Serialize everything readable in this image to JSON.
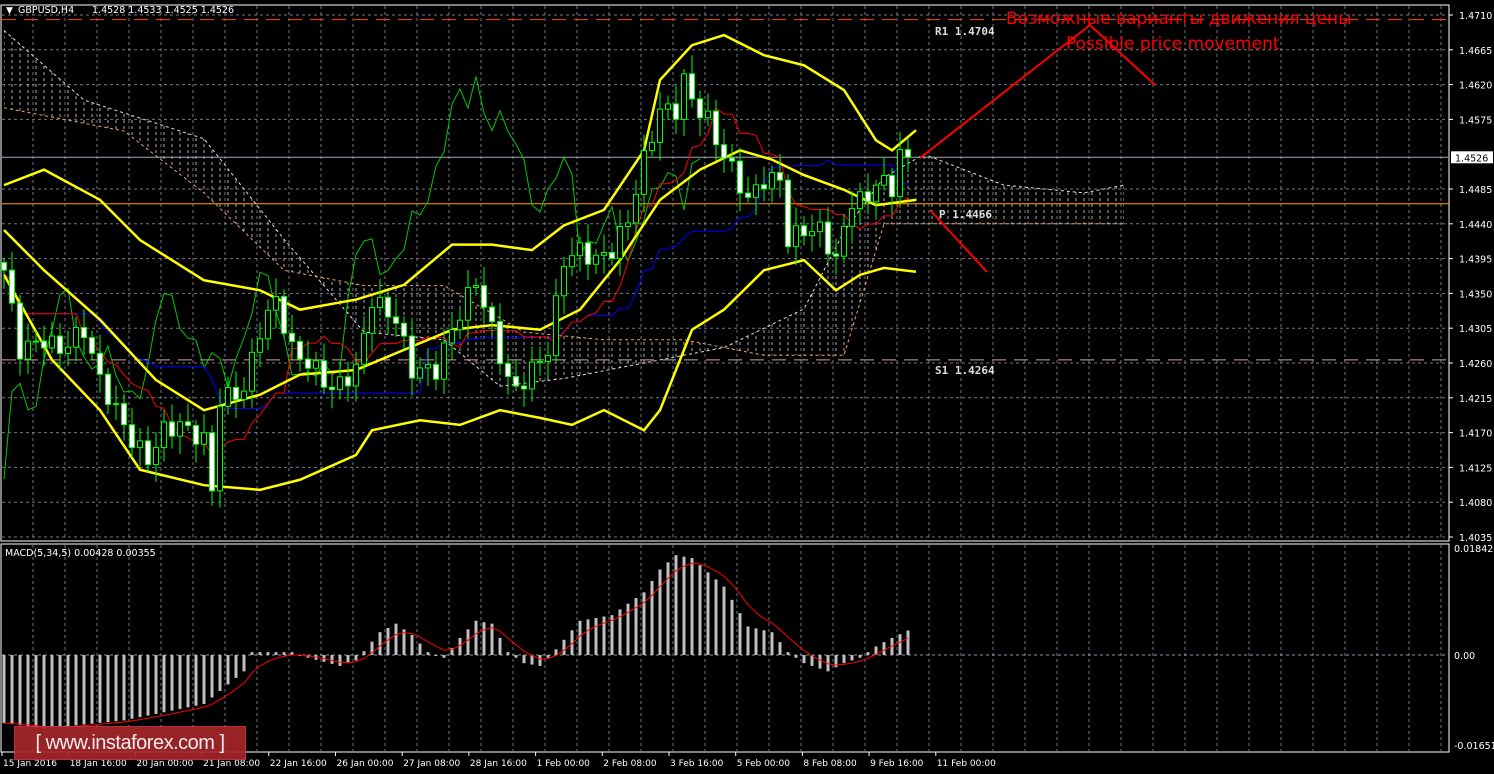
{
  "header": {
    "symbol": "GBPUSD,H4",
    "ohlc": "1.4528 1.4533 1.4525 1.4526"
  },
  "macd_header": {
    "label": "MACD(5,34,5) 0.00428 0.00355"
  },
  "annotations": {
    "ru": "Возможные варианты движения цены",
    "en": "Possible price movement",
    "r1": "R1 1.4704",
    "p": "P 1.4466",
    "s1": "S1 1.4264"
  },
  "logo": "[ www.instaforex.com ]",
  "colors": {
    "bg": "#000000",
    "grid": "#8c96a6",
    "candle": "#00ff00",
    "bands": "#ffff00",
    "tenkan": "#ff0000",
    "kijun": "#0000ff",
    "chikou": "#00c800",
    "arrow": "#ff0000",
    "pivot": "#ffa500"
  },
  "chart_data": {
    "type": "candlestick",
    "title": "GBPUSD,H4",
    "price_axis": {
      "ylim": [
        1.4035,
        1.471
      ],
      "ticks": [
        "1.4710",
        "1.4665",
        "1.4620",
        "1.4575",
        "1.4526",
        "1.4485",
        "1.4440",
        "1.4395",
        "1.4350",
        "1.4305",
        "1.4260",
        "1.4215",
        "1.4170",
        "1.4125",
        "1.4080",
        "1.4035"
      ],
      "current": 1.4526
    },
    "levels": {
      "R1": 1.4704,
      "P": 1.4466,
      "S1": 1.4264
    },
    "time_labels": [
      "15 Jan 2016",
      "18 Jan 16:00",
      "20 Jan 00:00",
      "21 Jan 08:00",
      "22 Jan 16:00",
      "26 Jan 00:00",
      "27 Jan 08:00",
      "28 Jan 16:00",
      "1 Feb 00:00",
      "2 Feb 08:00",
      "3 Feb 16:00",
      "5 Feb 00:00",
      "8 Feb 08:00",
      "9 Feb 16:00",
      "11 Feb 00:00"
    ],
    "bars": 114,
    "close_keypoints": [
      [
        0,
        1.438
      ],
      [
        2,
        1.4277
      ],
      [
        5,
        1.429
      ],
      [
        7,
        1.4277
      ],
      [
        10,
        1.4303
      ],
      [
        12,
        1.4238
      ],
      [
        14,
        1.4199
      ],
      [
        16,
        1.416
      ],
      [
        18,
        1.4135
      ],
      [
        20,
        1.4173
      ],
      [
        22,
        1.418
      ],
      [
        25,
        1.416
      ],
      [
        26,
        1.4096
      ],
      [
        27,
        1.4212
      ],
      [
        30,
        1.4225
      ],
      [
        32,
        1.4303
      ],
      [
        34,
        1.4342
      ],
      [
        36,
        1.4277
      ],
      [
        39,
        1.4251
      ],
      [
        41,
        1.4225
      ],
      [
        44,
        1.4251
      ],
      [
        46,
        1.4342
      ],
      [
        49,
        1.4316
      ],
      [
        51,
        1.4251
      ],
      [
        54,
        1.4251
      ],
      [
        56,
        1.4303
      ],
      [
        59,
        1.4367
      ],
      [
        61,
        1.4303
      ],
      [
        63,
        1.4238
      ],
      [
        64,
        1.4225
      ],
      [
        66,
        1.4251
      ],
      [
        68,
        1.4277
      ],
      [
        70,
        1.4393
      ],
      [
        72,
        1.4406
      ],
      [
        74,
        1.4393
      ],
      [
        76,
        1.4406
      ],
      [
        78,
        1.4445
      ],
      [
        80,
        1.4523
      ],
      [
        82,
        1.4587
      ],
      [
        84,
        1.4587
      ],
      [
        85,
        1.4626
      ],
      [
        86,
        1.46
      ],
      [
        88,
        1.4574
      ],
      [
        89,
        1.4548
      ],
      [
        91,
        1.451
      ],
      [
        93,
        1.4471
      ],
      [
        95,
        1.4497
      ],
      [
        97,
        1.4497
      ],
      [
        98,
        1.4419
      ],
      [
        100,
        1.4432
      ],
      [
        102,
        1.4432
      ],
      [
        104,
        1.4393
      ],
      [
        106,
        1.4471
      ],
      [
        108,
        1.4471
      ],
      [
        109,
        1.4497
      ],
      [
        111,
        1.4484
      ],
      [
        112,
        1.4536
      ],
      [
        113,
        1.4526
      ]
    ],
    "bollinger": {
      "upper": [
        [
          0,
          1.449
        ],
        [
          5,
          1.451
        ],
        [
          12,
          1.4471
        ],
        [
          17,
          1.4419
        ],
        [
          25,
          1.4367
        ],
        [
          32,
          1.4354
        ],
        [
          37,
          1.4329
        ],
        [
          44,
          1.4342
        ],
        [
          50,
          1.4361
        ],
        [
          56,
          1.4413
        ],
        [
          61,
          1.4413
        ],
        [
          66,
          1.4406
        ],
        [
          70,
          1.4438
        ],
        [
          75,
          1.4458
        ],
        [
          80,
          1.4535
        ],
        [
          82,
          1.4626
        ],
        [
          86,
          1.4671
        ],
        [
          90,
          1.4684
        ],
        [
          95,
          1.4658
        ],
        [
          100,
          1.4645
        ],
        [
          105,
          1.4613
        ],
        [
          109,
          1.4548
        ],
        [
          111,
          1.4535
        ],
        [
          114,
          1.4561
        ]
      ],
      "middle": [
        [
          0,
          1.4432
        ],
        [
          5,
          1.438
        ],
        [
          12,
          1.4316
        ],
        [
          19,
          1.4238
        ],
        [
          25,
          1.4199
        ],
        [
          32,
          1.4219
        ],
        [
          37,
          1.4245
        ],
        [
          44,
          1.4251
        ],
        [
          50,
          1.4277
        ],
        [
          56,
          1.4303
        ],
        [
          61,
          1.4309
        ],
        [
          67,
          1.4303
        ],
        [
          72,
          1.4329
        ],
        [
          77,
          1.4393
        ],
        [
          82,
          1.4471
        ],
        [
          87,
          1.451
        ],
        [
          92,
          1.4535
        ],
        [
          96,
          1.4523
        ],
        [
          100,
          1.4503
        ],
        [
          105,
          1.4484
        ],
        [
          109,
          1.4464
        ],
        [
          114,
          1.4471
        ]
      ],
      "lower": [
        [
          0,
          1.4374
        ],
        [
          6,
          1.4264
        ],
        [
          12,
          1.4199
        ],
        [
          17,
          1.4122
        ],
        [
          25,
          1.4102
        ],
        [
          32,
          1.4096
        ],
        [
          37,
          1.4109
        ],
        [
          44,
          1.4141
        ],
        [
          46,
          1.4173
        ],
        [
          52,
          1.4186
        ],
        [
          57,
          1.418
        ],
        [
          62,
          1.4199
        ],
        [
          67,
          1.4189
        ],
        [
          71,
          1.418
        ],
        [
          75,
          1.4199
        ],
        [
          80,
          1.4173
        ],
        [
          82,
          1.4199
        ],
        [
          86,
          1.4303
        ],
        [
          90,
          1.4329
        ],
        [
          95,
          1.438
        ],
        [
          100,
          1.4393
        ],
        [
          104,
          1.4354
        ],
        [
          107,
          1.4374
        ],
        [
          110,
          1.4383
        ],
        [
          114,
          1.4378
        ]
      ]
    },
    "ichimoku_cloud": {
      "span_a": [
        [
          0,
          1.469
        ],
        [
          10,
          1.46
        ],
        [
          25,
          1.455
        ],
        [
          35,
          1.442
        ],
        [
          45,
          1.43
        ],
        [
          55,
          1.429
        ],
        [
          62,
          1.423
        ],
        [
          70,
          1.424
        ],
        [
          80,
          1.426
        ],
        [
          90,
          1.428
        ],
        [
          100,
          1.433
        ],
        [
          105,
          1.443
        ],
        [
          110,
          1.45
        ],
        [
          115,
          1.453
        ],
        [
          125,
          1.449
        ],
        [
          135,
          1.448
        ],
        [
          140,
          1.449
        ]
      ],
      "span_b": [
        [
          0,
          1.459
        ],
        [
          15,
          1.456
        ],
        [
          25,
          1.448
        ],
        [
          35,
          1.438
        ],
        [
          45,
          1.436
        ],
        [
          55,
          1.436
        ],
        [
          65,
          1.43
        ],
        [
          75,
          1.429
        ],
        [
          85,
          1.429
        ],
        [
          95,
          1.427
        ],
        [
          105,
          1.427
        ],
        [
          110,
          1.444
        ],
        [
          120,
          1.444
        ],
        [
          130,
          1.444
        ],
        [
          140,
          1.444
        ]
      ]
    },
    "macd": {
      "params": "5,34,5",
      "ylim": [
        -0.01651,
        0.01842
      ],
      "ticks": [
        "0.01842",
        "0.00",
        "-0.01651"
      ],
      "histogram_keypoints": [
        [
          0,
          -0.0125
        ],
        [
          5,
          -0.0135
        ],
        [
          15,
          -0.012
        ],
        [
          25,
          -0.009
        ],
        [
          30,
          -0.003
        ],
        [
          31,
          0.0005
        ],
        [
          36,
          0.0005
        ],
        [
          38,
          -0.0005
        ],
        [
          42,
          -0.002
        ],
        [
          44,
          -0.001
        ],
        [
          47,
          0.004
        ],
        [
          49,
          0.0055
        ],
        [
          51,
          0.0035
        ],
        [
          53,
          0.0005
        ],
        [
          55,
          -0.0005
        ],
        [
          57,
          0.003
        ],
        [
          59,
          0.006
        ],
        [
          61,
          0.0055
        ],
        [
          63,
          0.0005
        ],
        [
          65,
          -0.0015
        ],
        [
          67,
          -0.002
        ],
        [
          69,
          0.001
        ],
        [
          72,
          0.006
        ],
        [
          76,
          0.007
        ],
        [
          80,
          0.011
        ],
        [
          82,
          0.015
        ],
        [
          84,
          0.0175
        ],
        [
          86,
          0.017
        ],
        [
          90,
          0.012
        ],
        [
          93,
          0.005
        ],
        [
          96,
          0.004
        ],
        [
          98,
          0.0005
        ],
        [
          100,
          -0.0015
        ],
        [
          103,
          -0.003
        ],
        [
          105,
          -0.0015
        ],
        [
          107,
          -0.0005
        ],
        [
          109,
          0.0015
        ],
        [
          111,
          0.003
        ],
        [
          113,
          0.0043
        ]
      ]
    }
  }
}
